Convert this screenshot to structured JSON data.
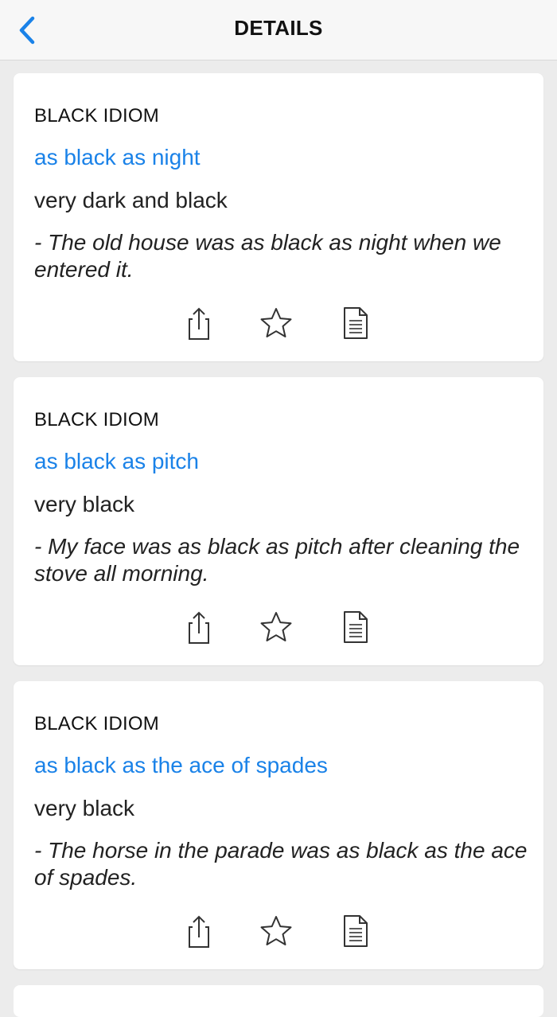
{
  "header": {
    "title": "DETAILS",
    "back_icon": "chevron-left-icon"
  },
  "colors": {
    "accent": "#1a82e8",
    "background": "#ececec",
    "card": "#ffffff"
  },
  "cards": [
    {
      "category": "BLACK IDIOM",
      "idiom": "as black as night",
      "meaning": "very dark and black",
      "example": "- The old house was as black as night when we entered it."
    },
    {
      "category": "BLACK IDIOM",
      "idiom": "as black as pitch",
      "meaning": "very black",
      "example": "- My face was as black as pitch after cleaning the stove all morning."
    },
    {
      "category": "BLACK IDIOM",
      "idiom": "as black as the ace of spades",
      "meaning": "very black",
      "example": "- The horse in the parade was as black as the ace of spades."
    }
  ],
  "actions": [
    "share-icon",
    "star-icon",
    "document-icon"
  ]
}
